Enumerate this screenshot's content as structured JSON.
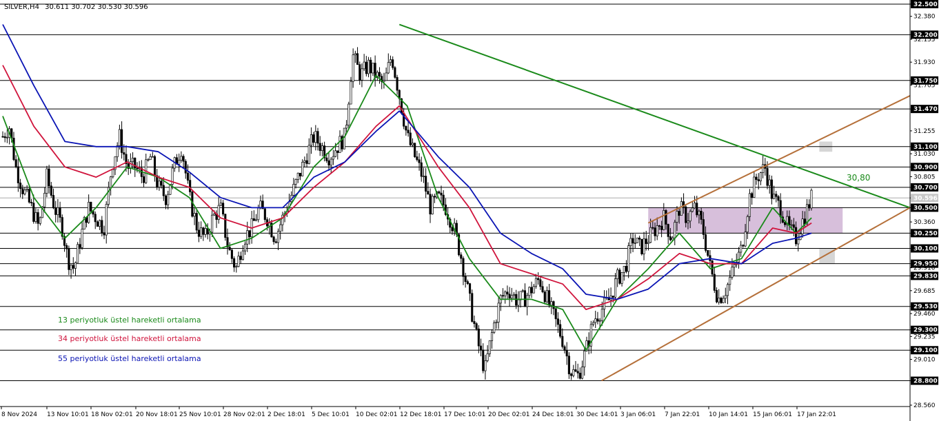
{
  "header": {
    "symbol_timeframe": "SILVER,H4",
    "ohlc": "30.611 30.702 30.530 30.596"
  },
  "legend": [
    {
      "label": "13 periyotluk üstel hareketli ortalama",
      "color": "#1a8a1a"
    },
    {
      "label": "34 periyotluk üstel hareketli ortalama",
      "color": "#d0143c"
    },
    {
      "label": "55 periyotluk üstel hareketli ortalama",
      "color": "#0a14b4"
    }
  ],
  "annotation": {
    "text": "30,80",
    "color": "#1a8a1a"
  },
  "colors": {
    "candle": "#000000",
    "resistance_trendline": "#1a8a1a",
    "channel_lines": "#b5703a",
    "zone_fill": "#c9a9cf",
    "small_zone_fill": "#cccccc",
    "level_line": "#000000",
    "level_label_bg": "#000000",
    "current_price_line": "#aaaaaa"
  },
  "chart_data": {
    "type": "candlestick",
    "title": "",
    "xlabel": "",
    "ylabel": "",
    "ylim": [
      28.56,
      32.5
    ],
    "grid": false,
    "y_ticks": [
      "32.500",
      "32.380",
      "32.200",
      "32.155",
      "31.930",
      "31.750",
      "31.705",
      "31.470",
      "31.255",
      "31.100",
      "31.030",
      "30.900",
      "30.805",
      "30.700",
      "30.596",
      "30.500",
      "30.360",
      "30.250",
      "30.100",
      "29.950",
      "29.910",
      "29.830",
      "29.685",
      "29.530",
      "29.460",
      "29.300",
      "29.235",
      "29.100",
      "29.010",
      "28.800",
      "28.560"
    ],
    "x_ticks": [
      "8 Nov 2024",
      "13 Nov 10:01",
      "18 Nov 02:01",
      "20 Nov 18:01",
      "25 Nov 10:01",
      "28 Nov 02:01",
      "2 Dec 18:01",
      "5 Dec 10:01",
      "10 Dec 02:01",
      "12 Dec 18:01",
      "17 Dec 10:01",
      "20 Dec 02:01",
      "24 Dec 18:01",
      "30 Dec 14:01",
      "3 Jan 06:01",
      "7 Jan 22:01",
      "10 Jan 14:01",
      "15 Jan 06:01",
      "17 Jan 22:01"
    ],
    "horizontal_levels": [
      32.5,
      32.2,
      31.75,
      31.47,
      31.1,
      30.9,
      30.7,
      30.5,
      30.25,
      30.1,
      29.95,
      29.83,
      29.53,
      29.3,
      29.1,
      28.8
    ],
    "current_price": 30.596,
    "price_path_points": [
      [
        0,
        31.2
      ],
      [
        5,
        31.3
      ],
      [
        10,
        30.9
      ],
      [
        15,
        30.7
      ],
      [
        22,
        30.5
      ],
      [
        28,
        30.3
      ],
      [
        34,
        30.8
      ],
      [
        40,
        30.5
      ],
      [
        46,
        30.3
      ],
      [
        50,
        30.0
      ],
      [
        55,
        29.9
      ],
      [
        60,
        30.2
      ],
      [
        66,
        30.5
      ],
      [
        72,
        30.4
      ],
      [
        78,
        30.3
      ],
      [
        84,
        30.9
      ],
      [
        90,
        31.2
      ],
      [
        96,
        30.9
      ],
      [
        102,
        30.9
      ],
      [
        108,
        30.8
      ],
      [
        114,
        31.0
      ],
      [
        120,
        30.7
      ],
      [
        126,
        30.6
      ],
      [
        132,
        30.9
      ],
      [
        138,
        31.1
      ],
      [
        144,
        30.6
      ],
      [
        150,
        30.3
      ],
      [
        156,
        30.2
      ],
      [
        162,
        30.4
      ],
      [
        168,
        30.5
      ],
      [
        174,
        30.1
      ],
      [
        180,
        29.9
      ],
      [
        186,
        30.2
      ],
      [
        192,
        30.3
      ],
      [
        198,
        30.5
      ],
      [
        204,
        30.4
      ],
      [
        210,
        30.2
      ],
      [
        216,
        30.4
      ],
      [
        222,
        30.6
      ],
      [
        228,
        30.8
      ],
      [
        234,
        31.0
      ],
      [
        240,
        31.2
      ],
      [
        246,
        31.1
      ],
      [
        252,
        31.0
      ],
      [
        258,
        31.1
      ],
      [
        264,
        31.2
      ],
      [
        270,
        32.0
      ],
      [
        276,
        31.8
      ],
      [
        282,
        31.9
      ],
      [
        288,
        31.8
      ],
      [
        294,
        31.7
      ],
      [
        300,
        32.0
      ],
      [
        306,
        31.6
      ],
      [
        312,
        31.2
      ],
      [
        318,
        31.0
      ],
      [
        324,
        30.8
      ],
      [
        330,
        30.5
      ],
      [
        336,
        30.6
      ],
      [
        342,
        30.5
      ],
      [
        348,
        30.3
      ],
      [
        354,
        30.0
      ],
      [
        360,
        29.6
      ],
      [
        366,
        29.2
      ],
      [
        372,
        28.9
      ],
      [
        378,
        29.3
      ],
      [
        384,
        29.6
      ],
      [
        390,
        29.7
      ],
      [
        396,
        29.6
      ],
      [
        402,
        29.6
      ],
      [
        408,
        29.7
      ],
      [
        414,
        29.8
      ],
      [
        420,
        29.6
      ],
      [
        426,
        29.4
      ],
      [
        432,
        29.2
      ],
      [
        438,
        28.9
      ],
      [
        444,
        28.85
      ],
      [
        450,
        29.1
      ],
      [
        456,
        29.4
      ],
      [
        462,
        29.5
      ],
      [
        468,
        29.6
      ],
      [
        474,
        29.8
      ],
      [
        480,
        29.9
      ],
      [
        486,
        30.2
      ],
      [
        492,
        30.1
      ],
      [
        498,
        30.2
      ],
      [
        504,
        30.3
      ],
      [
        510,
        30.4
      ],
      [
        516,
        30.2
      ],
      [
        522,
        30.5
      ],
      [
        528,
        30.4
      ],
      [
        534,
        30.5
      ],
      [
        540,
        30.3
      ],
      [
        546,
        29.9
      ],
      [
        552,
        29.6
      ],
      [
        558,
        29.7
      ],
      [
        564,
        29.9
      ],
      [
        570,
        30.1
      ],
      [
        576,
        30.6
      ],
      [
        582,
        30.8
      ],
      [
        588,
        30.9
      ],
      [
        594,
        30.6
      ],
      [
        600,
        30.5
      ],
      [
        606,
        30.3
      ],
      [
        612,
        30.2
      ],
      [
        618,
        30.4
      ],
      [
        624,
        30.6
      ]
    ],
    "series": [
      {
        "name": "13 periyotluk üstel hareketli ortalama",
        "values": [
          [
            0,
            31.4
          ],
          [
            24,
            30.6
          ],
          [
            48,
            30.2
          ],
          [
            72,
            30.5
          ],
          [
            96,
            30.9
          ],
          [
            120,
            30.8
          ],
          [
            144,
            30.6
          ],
          [
            168,
            30.1
          ],
          [
            192,
            30.2
          ],
          [
            216,
            30.4
          ],
          [
            240,
            30.9
          ],
          [
            264,
            31.2
          ],
          [
            288,
            31.8
          ],
          [
            312,
            31.5
          ],
          [
            336,
            30.6
          ],
          [
            360,
            30.0
          ],
          [
            384,
            29.6
          ],
          [
            408,
            29.6
          ],
          [
            432,
            29.5
          ],
          [
            450,
            29.1
          ],
          [
            474,
            29.6
          ],
          [
            498,
            29.9
          ],
          [
            522,
            30.25
          ],
          [
            546,
            29.9
          ],
          [
            570,
            30.0
          ],
          [
            594,
            30.5
          ],
          [
            612,
            30.25
          ],
          [
            624,
            30.4
          ]
        ]
      },
      {
        "name": "34 periyotluk üstel hareketli ortalama",
        "values": [
          [
            0,
            31.9
          ],
          [
            24,
            31.3
          ],
          [
            48,
            30.9
          ],
          [
            72,
            30.8
          ],
          [
            96,
            30.95
          ],
          [
            120,
            30.8
          ],
          [
            144,
            30.7
          ],
          [
            168,
            30.4
          ],
          [
            192,
            30.3
          ],
          [
            216,
            30.4
          ],
          [
            240,
            30.7
          ],
          [
            264,
            30.95
          ],
          [
            288,
            31.3
          ],
          [
            306,
            31.5
          ],
          [
            336,
            30.9
          ],
          [
            360,
            30.5
          ],
          [
            384,
            29.95
          ],
          [
            408,
            29.85
          ],
          [
            432,
            29.75
          ],
          [
            450,
            29.5
          ],
          [
            474,
            29.6
          ],
          [
            498,
            29.8
          ],
          [
            522,
            30.05
          ],
          [
            546,
            29.95
          ],
          [
            570,
            29.95
          ],
          [
            594,
            30.3
          ],
          [
            612,
            30.25
          ],
          [
            624,
            30.35
          ]
        ]
      },
      {
        "name": "55 periyotluk üstel hareketli ortalama",
        "values": [
          [
            0,
            32.3
          ],
          [
            24,
            31.7
          ],
          [
            48,
            31.15
          ],
          [
            72,
            31.1
          ],
          [
            96,
            31.1
          ],
          [
            120,
            31.05
          ],
          [
            144,
            30.85
          ],
          [
            168,
            30.6
          ],
          [
            192,
            30.5
          ],
          [
            216,
            30.5
          ],
          [
            240,
            30.8
          ],
          [
            264,
            30.95
          ],
          [
            288,
            31.25
          ],
          [
            306,
            31.45
          ],
          [
            336,
            31.0
          ],
          [
            360,
            30.7
          ],
          [
            384,
            30.25
          ],
          [
            408,
            30.05
          ],
          [
            432,
            29.9
          ],
          [
            450,
            29.65
          ],
          [
            474,
            29.6
          ],
          [
            498,
            29.7
          ],
          [
            522,
            29.95
          ],
          [
            546,
            30.0
          ],
          [
            570,
            29.95
          ],
          [
            594,
            30.15
          ],
          [
            612,
            30.2
          ],
          [
            624,
            30.25
          ]
        ]
      }
    ],
    "trendlines": [
      {
        "name": "resistance",
        "from": [
          306,
          32.3
        ],
        "to": [
          700,
          30.5
        ]
      },
      {
        "name": "channel-top",
        "from": [
          498,
          30.35
        ],
        "to": [
          700,
          31.6
        ]
      },
      {
        "name": "channel-bottom",
        "from": [
          462,
          28.8
        ],
        "to": [
          700,
          30.5
        ]
      }
    ],
    "zones": [
      {
        "name": "supply-demand-zone",
        "x": [
          498,
          648
        ],
        "y": [
          30.25,
          30.5
        ]
      },
      {
        "name": "upper-small-zone",
        "x": [
          630,
          640
        ],
        "y": [
          31.05,
          31.15
        ]
      },
      {
        "name": "lower-small-zone",
        "x": [
          630,
          642
        ],
        "y": [
          29.95,
          30.1
        ]
      }
    ]
  }
}
